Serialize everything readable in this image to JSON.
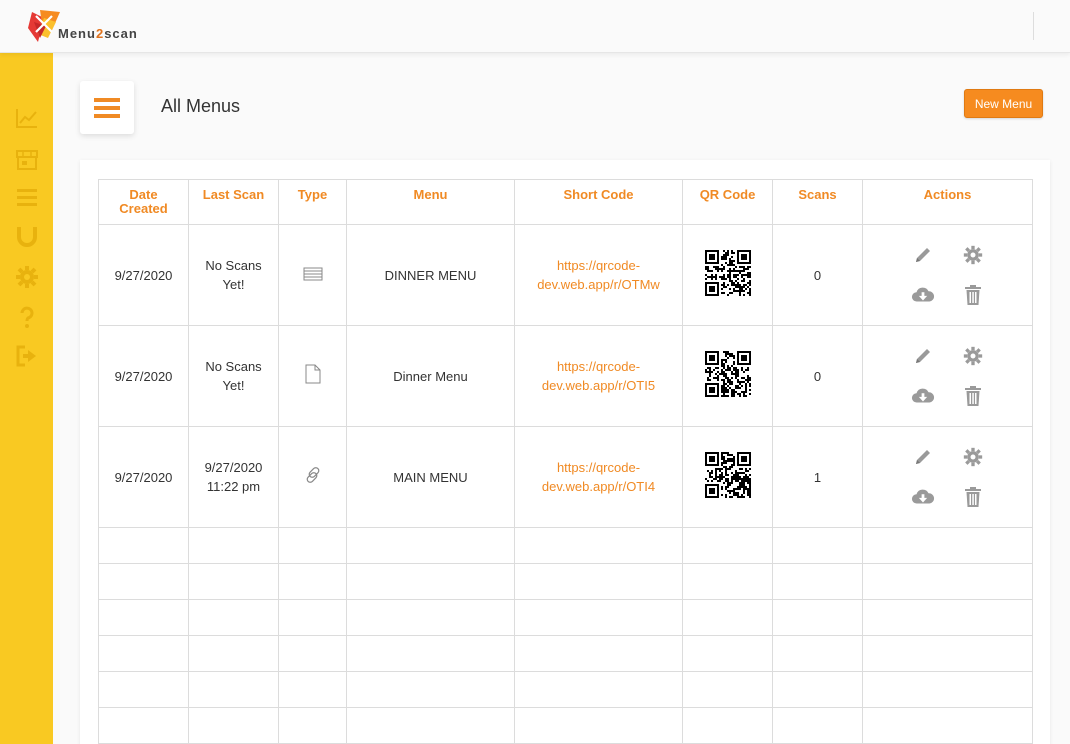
{
  "brand": {
    "name_part1": "Menu",
    "name_part2": "2",
    "name_part3": "scan",
    "accent": "#f68b1f",
    "sidebar_color": "#f9c922"
  },
  "sidebar": {
    "items": [
      {
        "icon": "chart-line-icon"
      },
      {
        "icon": "store-icon"
      },
      {
        "icon": "bars-icon"
      },
      {
        "icon": "magnet-icon"
      },
      {
        "icon": "gear-icon"
      },
      {
        "icon": "question-icon"
      },
      {
        "icon": "sign-out-icon"
      }
    ]
  },
  "header": {
    "title": "All Menus",
    "new_menu_label": "New Menu"
  },
  "table": {
    "columns": {
      "date_line1": "Date",
      "date_line2": "Created",
      "last_scan": "Last Scan",
      "type": "Type",
      "menu": "Menu",
      "short_code": "Short Code",
      "qr_code": "QR Code",
      "scans": "Scans",
      "actions": "Actions"
    },
    "rows": [
      {
        "date": "9/27/2020",
        "last_scan_line1": "No Scans",
        "last_scan_line2": "Yet!",
        "type_icon": "list-icon",
        "menu": "DINNER MENU",
        "short_code_line1": "https://qrcode-",
        "short_code_line2": "dev.web.app/r/OTMw",
        "scans": "0"
      },
      {
        "date": "9/27/2020",
        "last_scan_line1": "No Scans",
        "last_scan_line2": "Yet!",
        "type_icon": "file-icon",
        "menu": "Dinner Menu",
        "short_code_line1": "https://qrcode-",
        "short_code_line2": "dev.web.app/r/OTI5",
        "scans": "0"
      },
      {
        "date": "9/27/2020",
        "last_scan_line1": "9/27/2020",
        "last_scan_line2": "11:22 pm",
        "type_icon": "link-icon",
        "menu": "MAIN MENU",
        "short_code_line1": "https://qrcode-",
        "short_code_line2": "dev.web.app/r/OTI4",
        "scans": "1"
      }
    ]
  }
}
